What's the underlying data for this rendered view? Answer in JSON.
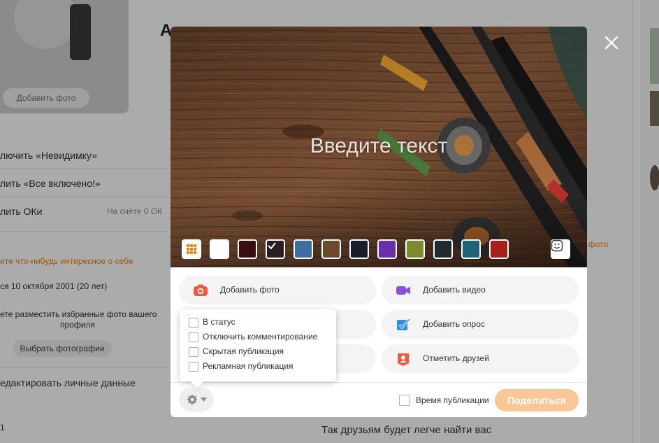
{
  "background": {
    "left_menu": {
      "avatar_button": "Добавить фото",
      "items": [
        "лючить «Невидимку»",
        "лить «Все включено!»",
        "лить ОКи"
      ],
      "balance": "На счёте 0 ОК",
      "orange_link": "ите что-нибудь интересное о себе",
      "birthday": "ся 10 октября 2001 (20 лет)",
      "photos_hint_line1": "ете разместить избранные фото вашего",
      "photos_hint_line2": "профиля",
      "pick_photos_button": "Выбрать фотографии",
      "edit_data": "едактировать личные данные",
      "bottom_counter": "1"
    },
    "title_partial": "А",
    "right_orange": "фото",
    "bottom_hint": "Так друзьям будет легче найти вас"
  },
  "modal": {
    "cover_placeholder": "Введите текст",
    "swatches": [
      {
        "name": "swatch-white",
        "color": "#ffffff"
      },
      {
        "name": "swatch-dark-red",
        "color": "#3a0d10"
      },
      {
        "name": "swatch-selected",
        "color": "#2b1e22"
      },
      {
        "name": "swatch-blue-art",
        "color": "#3f6ea0"
      },
      {
        "name": "swatch-brown-art",
        "color": "#6d4a2e"
      },
      {
        "name": "swatch-suit",
        "color": "#1a1e2c"
      },
      {
        "name": "swatch-purple-art",
        "color": "#6a2ea8"
      },
      {
        "name": "swatch-olive",
        "color": "#7d8a2c"
      },
      {
        "name": "swatch-dark-scene",
        "color": "#1f2a33"
      },
      {
        "name": "swatch-cyan-art",
        "color": "#1d6277"
      },
      {
        "name": "swatch-red",
        "color": "#a8201d"
      }
    ],
    "actions": {
      "add_photo": "Добавить фото",
      "add_video": "Добавить видео",
      "add_poll": "Добавить опрос",
      "tag_friends": "Отметить друзей"
    },
    "settings_popup": {
      "options": [
        "В статус",
        "Отключить комментирование",
        "Скрытая публикация",
        "Рекламная публикация"
      ]
    },
    "footer": {
      "publish_time_label": "Время публикации",
      "share_button": "Поделиться"
    }
  },
  "colors": {
    "accent": "#ee8208",
    "share_disabled": "#fbc797",
    "video_icon": "#8d4fe0",
    "poll_icon": "#2c8ee8",
    "camera_icon": "#ee5a3c"
  }
}
